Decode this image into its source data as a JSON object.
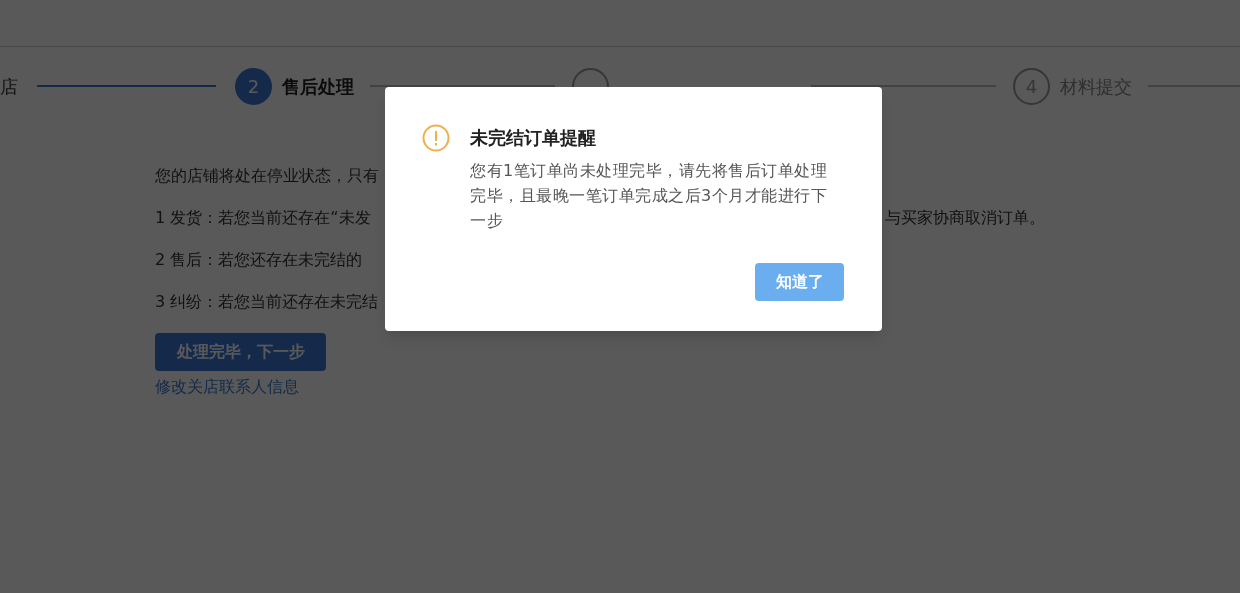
{
  "steps": [
    {
      "label": "店",
      "completed": true,
      "selected": false
    },
    {
      "number": "2",
      "label": "售后处理",
      "completed": false,
      "selected": true
    },
    {
      "completed": false,
      "selected": false
    },
    {
      "number": "4",
      "label": "材料提交",
      "completed": false,
      "selected": false
    }
  ],
  "notice_lines": [
    {
      "text": "您的店铺将处在停业状态，只有"
    },
    {
      "text": "1 发货：若您当前还存在“未发",
      "tail": "与买家协商取消订单。"
    },
    {
      "text": "2 售后：若您还存在未完结的"
    },
    {
      "text": "3 纠纷：若您当前还存在未完结"
    }
  ],
  "next_button": "处理完毕，下一步",
  "contact_link": "修改关店联系人信息",
  "dialog": {
    "title": "未完结订单提醒",
    "message": "您有1笔订单尚未处理完毕，请先将售后订单处理完毕，且最晚一笔订单完成之后3个月才能进行下一步",
    "button": "知道了"
  }
}
